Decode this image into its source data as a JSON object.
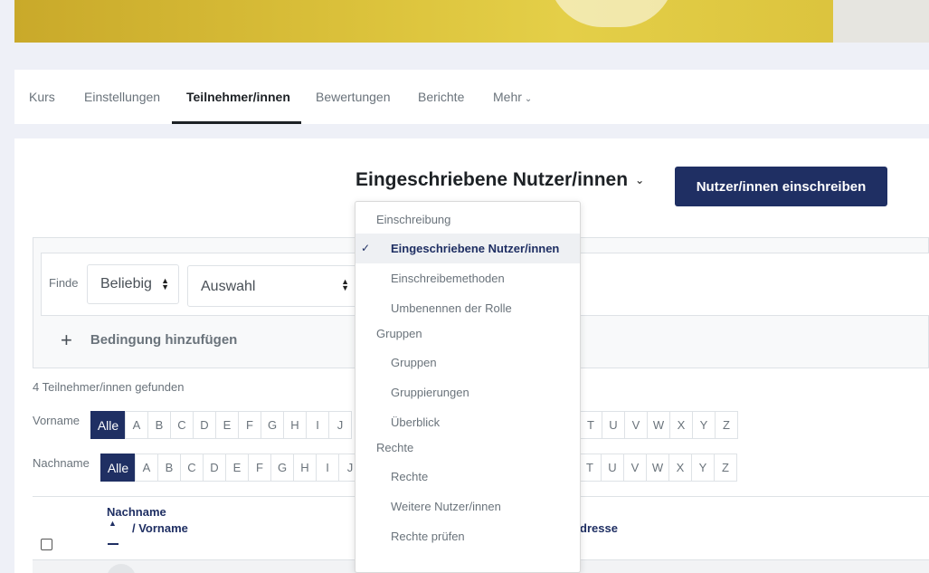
{
  "secondary_nav": {
    "items": [
      {
        "label": "Kurs"
      },
      {
        "label": "Einstellungen"
      },
      {
        "label": "Teilnehmer/innen",
        "active": true
      },
      {
        "label": "Bewertungen"
      },
      {
        "label": "Berichte"
      },
      {
        "label": "Mehr"
      }
    ]
  },
  "page": {
    "heading": "Eingeschriebene Nutzer/innen",
    "enrol_button": "Nutzer/innen einschreiben"
  },
  "filter": {
    "find_label": "Finde",
    "match_select": "Beliebig",
    "type_select": "Auswahl",
    "add_condition": "Bedingung hinzufügen"
  },
  "results": {
    "found_text": "4 Teilnehmer/innen gefunden"
  },
  "initials": {
    "firstname_label": "Vorname",
    "lastname_label": "Nachname",
    "all_label": "Alle",
    "letters_left": [
      "A",
      "B",
      "C",
      "D",
      "E",
      "F",
      "G",
      "H",
      "I",
      "J"
    ],
    "letters_right": [
      "T",
      "U",
      "V",
      "W",
      "X",
      "Y",
      "Z"
    ]
  },
  "table": {
    "col_lastname": "Nachname",
    "col_firstname": "/ Vorname",
    "col_email_partial": "dresse"
  },
  "dropdown": {
    "sections": [
      {
        "header": "Einschreibung",
        "items": [
          {
            "label": "Eingeschriebene Nutzer/innen",
            "selected": true
          },
          {
            "label": "Einschreibemethoden"
          },
          {
            "label": "Umbenennen der Rolle"
          }
        ]
      },
      {
        "header": "Gruppen",
        "items": [
          {
            "label": "Gruppen"
          },
          {
            "label": "Gruppierungen"
          },
          {
            "label": "Überblick"
          }
        ]
      },
      {
        "header": "Rechte",
        "items": [
          {
            "label": "Rechte"
          },
          {
            "label": "Weitere Nutzer/innen"
          },
          {
            "label": "Rechte prüfen"
          }
        ]
      }
    ]
  },
  "colors": {
    "primary": "#1f2f63",
    "muted_text": "#6a737b",
    "page_background": "#eef0f7"
  }
}
